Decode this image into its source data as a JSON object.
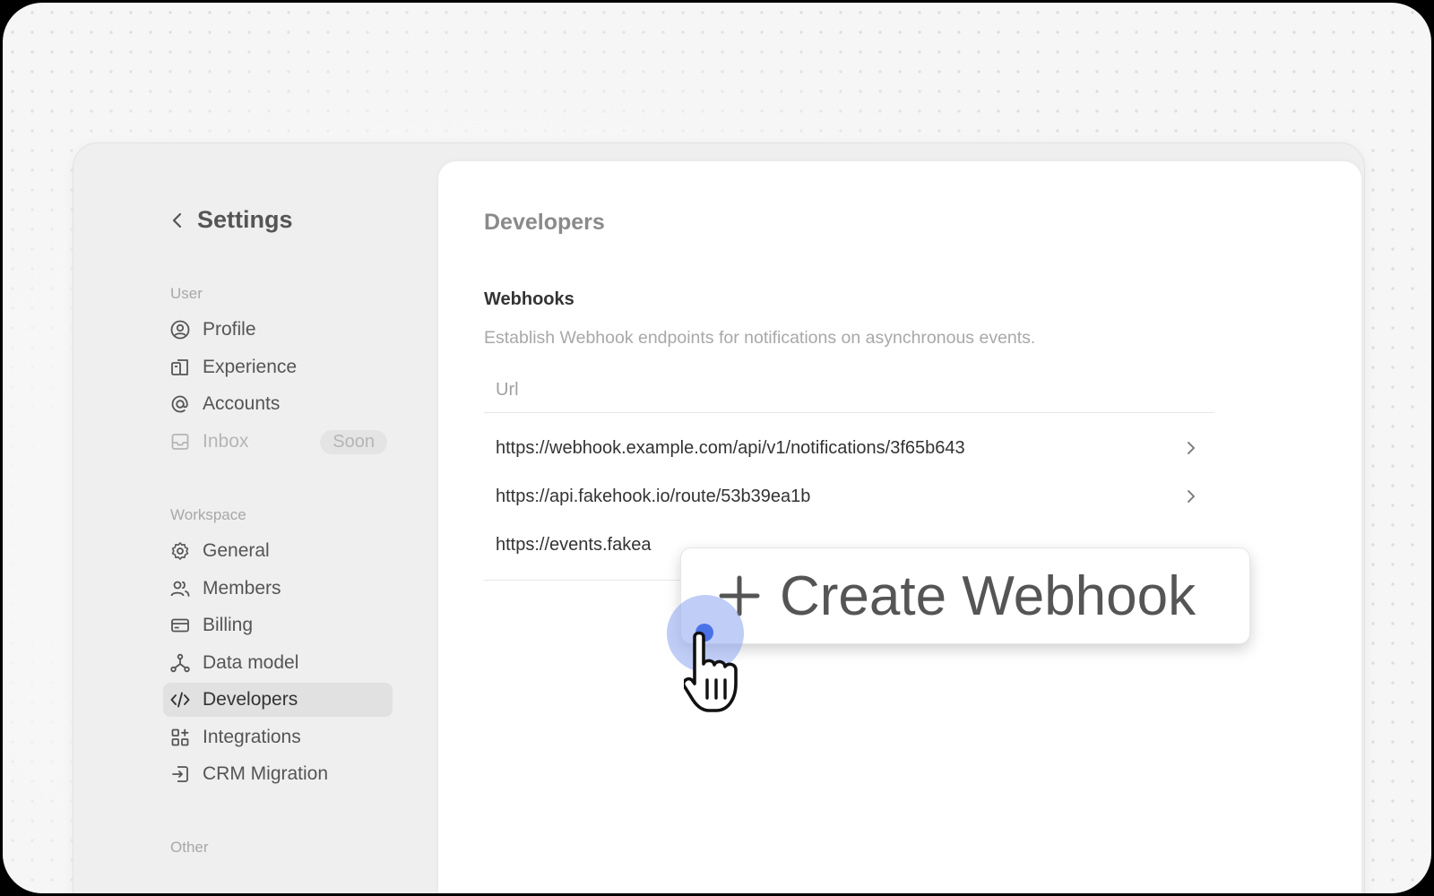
{
  "sidebar": {
    "back_title": "Settings",
    "sections": {
      "user": "User",
      "workspace": "Workspace",
      "other": "Other"
    },
    "user_items": [
      {
        "label": "Profile",
        "icon": "profile-icon"
      },
      {
        "label": "Experience",
        "icon": "experience-icon"
      },
      {
        "label": "Accounts",
        "icon": "at-sign-icon"
      },
      {
        "label": "Inbox",
        "icon": "inbox-icon",
        "badge": "Soon",
        "disabled": true
      }
    ],
    "workspace_items": [
      {
        "label": "General",
        "icon": "gear-icon"
      },
      {
        "label": "Members",
        "icon": "members-icon"
      },
      {
        "label": "Billing",
        "icon": "card-icon"
      },
      {
        "label": "Data model",
        "icon": "hierarchy-icon"
      },
      {
        "label": "Developers",
        "icon": "code-icon",
        "active": true
      },
      {
        "label": "Integrations",
        "icon": "apps-icon"
      },
      {
        "label": "CRM Migration",
        "icon": "import-icon"
      }
    ]
  },
  "main": {
    "page_title": "Developers",
    "webhooks": {
      "title": "Webhooks",
      "description": "Establish Webhook endpoints for notifications on asynchronous events.",
      "column_header": "Url",
      "rows": [
        "https://webhook.example.com/api/v1/notifications/3f65b643",
        "https://api.fakehook.io/route/53b39ea1b",
        "https://events.fakea"
      ]
    }
  },
  "popup": {
    "label": "Create Webhook",
    "icon": "plus-icon"
  },
  "colors": {
    "cursor_dot": "#4a72e8",
    "cursor_ring": "#8aa4f0",
    "active_nav_bg": "#e1e1e1"
  }
}
